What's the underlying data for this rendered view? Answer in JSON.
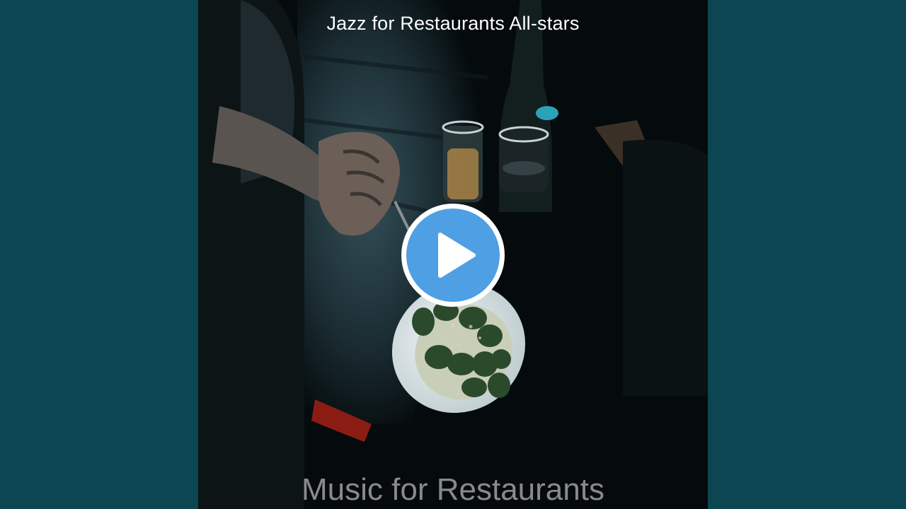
{
  "video": {
    "artist": "Jazz for Restaurants All-stars",
    "album": "Music for Restaurants",
    "play_icon": "play-icon",
    "accent_color": "#4f9fe4",
    "side_color": "#0b4652"
  }
}
